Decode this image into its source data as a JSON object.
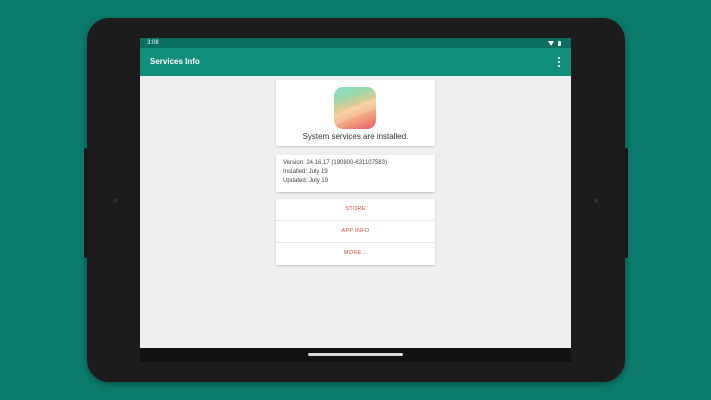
{
  "status_bar": {
    "time": "3:08",
    "icons": [
      "wifi-icon",
      "battery-icon"
    ]
  },
  "app_bar": {
    "title": "Services Info",
    "menu_icon": "more-vert-icon"
  },
  "logo_card": {
    "icon": "app-logo-icon",
    "message": "System services are installed."
  },
  "info_card": {
    "version": "Version: 24.16.17 (190800-631107583)",
    "installed": "Installed: July 19",
    "updated": "Updated: July 19"
  },
  "actions": {
    "store_label": "STORE",
    "app_info_label": "APP INFO",
    "more_label": "MORE..."
  },
  "colors": {
    "background": "#0b7a6a",
    "app_bar": "#12907b",
    "status_bar": "#0a6e61",
    "accent_text": "#d84a3a"
  }
}
